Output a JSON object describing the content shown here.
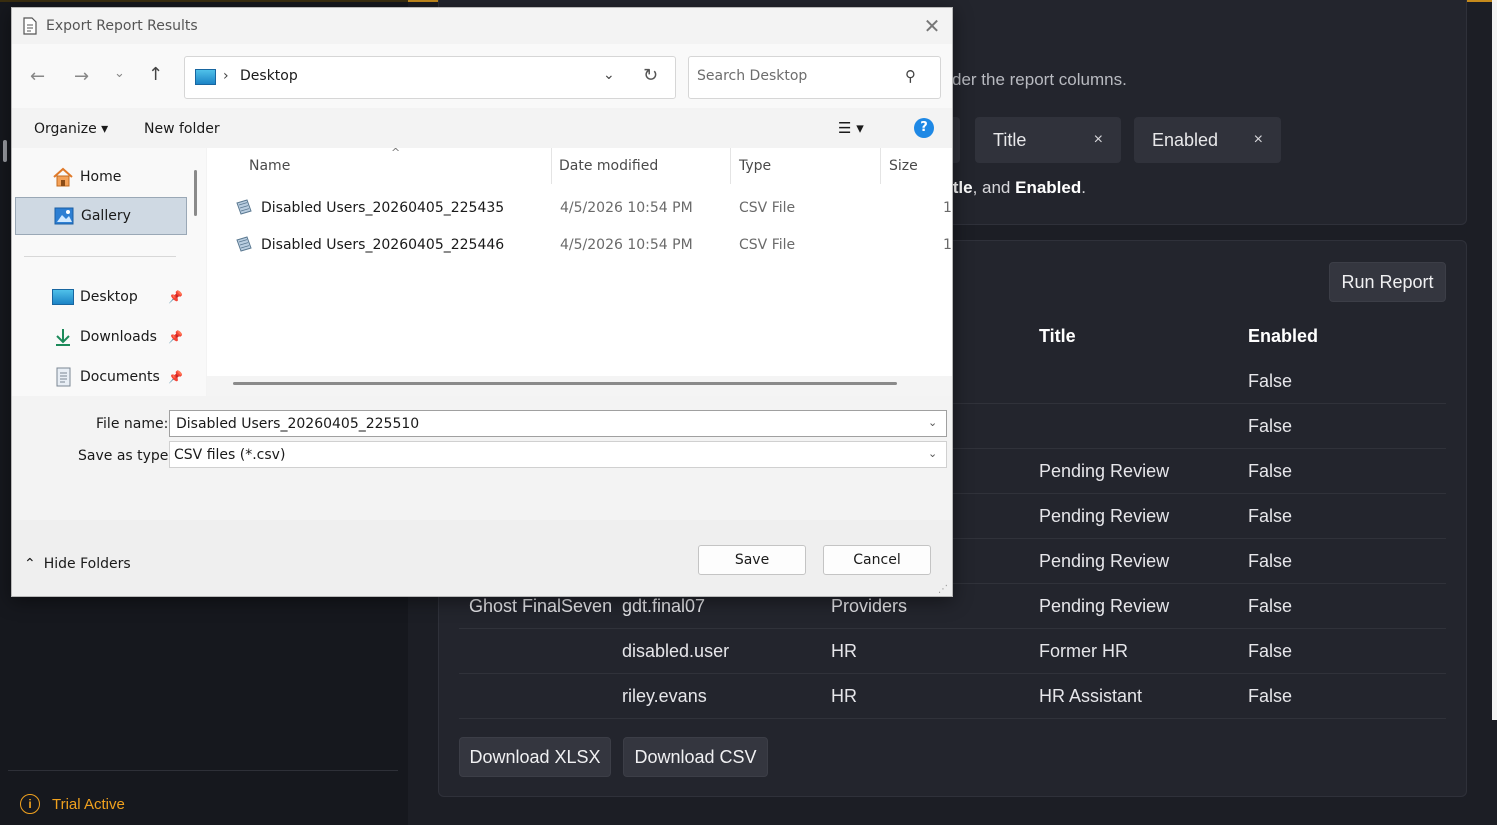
{
  "background": {
    "hint_text": "der the report columns.",
    "chips": [
      {
        "label": "Title",
        "remove": "×"
      },
      {
        "label": "Enabled",
        "remove": "×"
      }
    ],
    "summary": {
      "prefix": "itle",
      "middle": ", and ",
      "bold2": "Enabled",
      "suffix": "."
    },
    "run_report_label": "Run Report",
    "table": {
      "headers": [
        "Title",
        "Enabled"
      ],
      "rows": [
        {
          "display_name": "",
          "username": "",
          "department": "",
          "title": "",
          "enabled": "False"
        },
        {
          "display_name": "",
          "username": "",
          "department": "",
          "title": "",
          "enabled": "False"
        },
        {
          "display_name": "",
          "username": "",
          "department": "",
          "title": "Pending Review",
          "enabled": "False"
        },
        {
          "display_name": "",
          "username": "",
          "department": "",
          "title": "Pending Review",
          "enabled": "False"
        },
        {
          "display_name": "",
          "username": "",
          "department": "",
          "title": "Pending Review",
          "enabled": "False"
        },
        {
          "display_name": "Ghost FinalSeven",
          "username": "gdt.final07",
          "department": "Providers",
          "title": "Pending Review",
          "enabled": "False"
        },
        {
          "display_name": "",
          "username": "disabled.user",
          "department": "HR",
          "title": "Former HR",
          "enabled": "False"
        },
        {
          "display_name": "",
          "username": "riley.evans",
          "department": "HR",
          "title": "HR Assistant",
          "enabled": "False"
        }
      ]
    },
    "download_xlsx_label": "Download XLSX",
    "download_csv_label": "Download CSV",
    "trial_label": "Trial Active",
    "trial_icon": "i"
  },
  "dialog": {
    "title": "Export Report Results",
    "close": "✕",
    "address": {
      "separator": "›",
      "location": "Desktop"
    },
    "search_placeholder": "Search Desktop",
    "toolbar": {
      "organize": "Organize ▾",
      "new_folder": "New folder",
      "view": "☰ ▾",
      "help": "?"
    },
    "nav": {
      "home": "Home",
      "gallery": "Gallery",
      "desktop": "Desktop",
      "downloads": "Downloads",
      "documents": "Documents"
    },
    "columns": {
      "name": "Name",
      "date": "Date modified",
      "type": "Type",
      "size": "Size"
    },
    "files": [
      {
        "name": "Disabled Users_20260405_225435",
        "date": "4/5/2026 10:54 PM",
        "type": "CSV File",
        "size": "1"
      },
      {
        "name": "Disabled Users_20260405_225446",
        "date": "4/5/2026 10:54 PM",
        "type": "CSV File",
        "size": "1"
      }
    ],
    "file_name_label": "File name:",
    "file_name_value": "Disabled Users_20260405_225510",
    "save_as_label": "Save as type:",
    "save_as_value": "CSV files (*.csv)",
    "hide_folders": "Hide Folders",
    "save_label": "Save",
    "cancel_label": "Cancel"
  },
  "colors": {
    "accent": "#f0a11e",
    "help_blue": "#1e88e5",
    "dark_bg": "#1c1e25"
  }
}
